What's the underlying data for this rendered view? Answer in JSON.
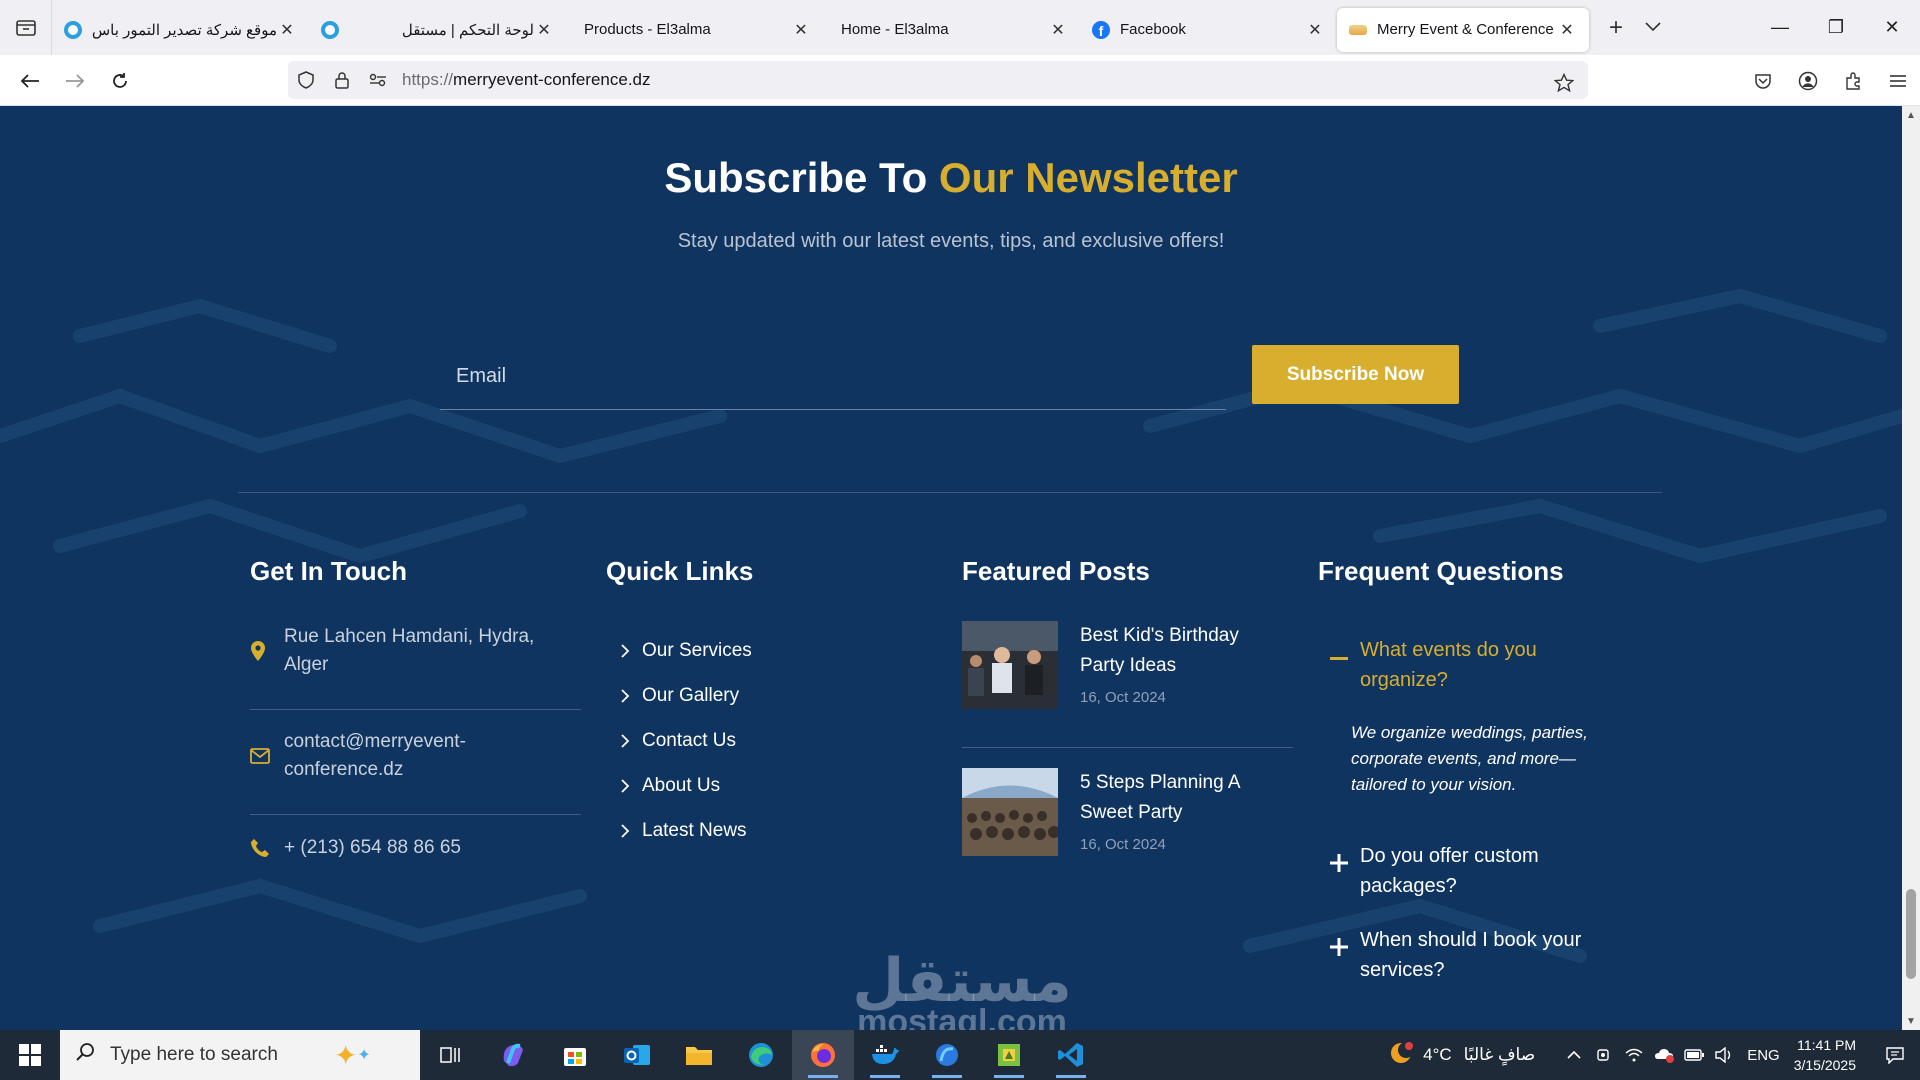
{
  "browser": {
    "tabs": [
      {
        "title": "موقع شركة تصدير التمور باس",
        "rtl": true,
        "favicon": "mostaql-favicon"
      },
      {
        "title": "لوحة التحكم | مستقل",
        "rtl": true,
        "favicon": "mostaql-favicon"
      },
      {
        "title": "Products - El3alma",
        "rtl": false,
        "favicon": "none"
      },
      {
        "title": "Home - El3alma",
        "rtl": false,
        "favicon": "none"
      },
      {
        "title": "Facebook",
        "rtl": false,
        "favicon": "facebook-favicon"
      },
      {
        "title": "Merry Event & Conference",
        "rtl": false,
        "favicon": "merry-favicon",
        "active": true
      }
    ],
    "url_scheme": "https://",
    "url_host": "merryevent-conference.dz"
  },
  "newsletter": {
    "title_white": "Subscribe To",
    "title_accent": "Our Newsletter",
    "subtitle": "Stay updated with our latest events, tips, and exclusive offers!",
    "email_placeholder": "Email",
    "button_label": "Subscribe Now"
  },
  "footer": {
    "contact": {
      "title": "Get In Touch",
      "address_line1": "Rue Lahcen Hamdani, Hydra,",
      "address_line2": "Alger",
      "email_line1": "contact@merryevent-",
      "email_line2": "conference.dz",
      "phone": "+ (213) 654 88 86 65"
    },
    "quick_links": {
      "title": "Quick Links",
      "items": [
        "Our Services",
        "Our Gallery",
        "Contact Us",
        "About Us",
        "Latest News"
      ]
    },
    "featured_posts": {
      "title": "Featured Posts",
      "posts": [
        {
          "title_line1": "Best Kid's Birthday",
          "title_line2": "Party Ideas",
          "date": "16, Oct 2024"
        },
        {
          "title_line1": "5 Steps Planning A",
          "title_line2": "Sweet Party",
          "date": "16, Oct 2024"
        }
      ]
    },
    "faq": {
      "title": "Frequent Questions",
      "items": [
        {
          "q1": "What events do you",
          "q2": "organize?",
          "open": true,
          "a1": "We organize weddings, parties,",
          "a2": "corporate events, and more—",
          "a3": "tailored to your vision."
        },
        {
          "q1": "Do you offer custom",
          "q2": "packages?",
          "open": false
        },
        {
          "q1": "When should I book your",
          "q2": "services?",
          "open": false
        }
      ]
    }
  },
  "watermark": {
    "arabic": "مستقل",
    "latin": "mostaql.com"
  },
  "taskbar": {
    "search_placeholder": "Type here to search",
    "weather": "4°C",
    "weather_desc": "صافٍ غالبًا",
    "lang": "ENG",
    "time": "11:41 PM",
    "date": "3/15/2025"
  },
  "colors": {
    "accent": "#d8ae2f",
    "page_bg": "#0f3460"
  }
}
